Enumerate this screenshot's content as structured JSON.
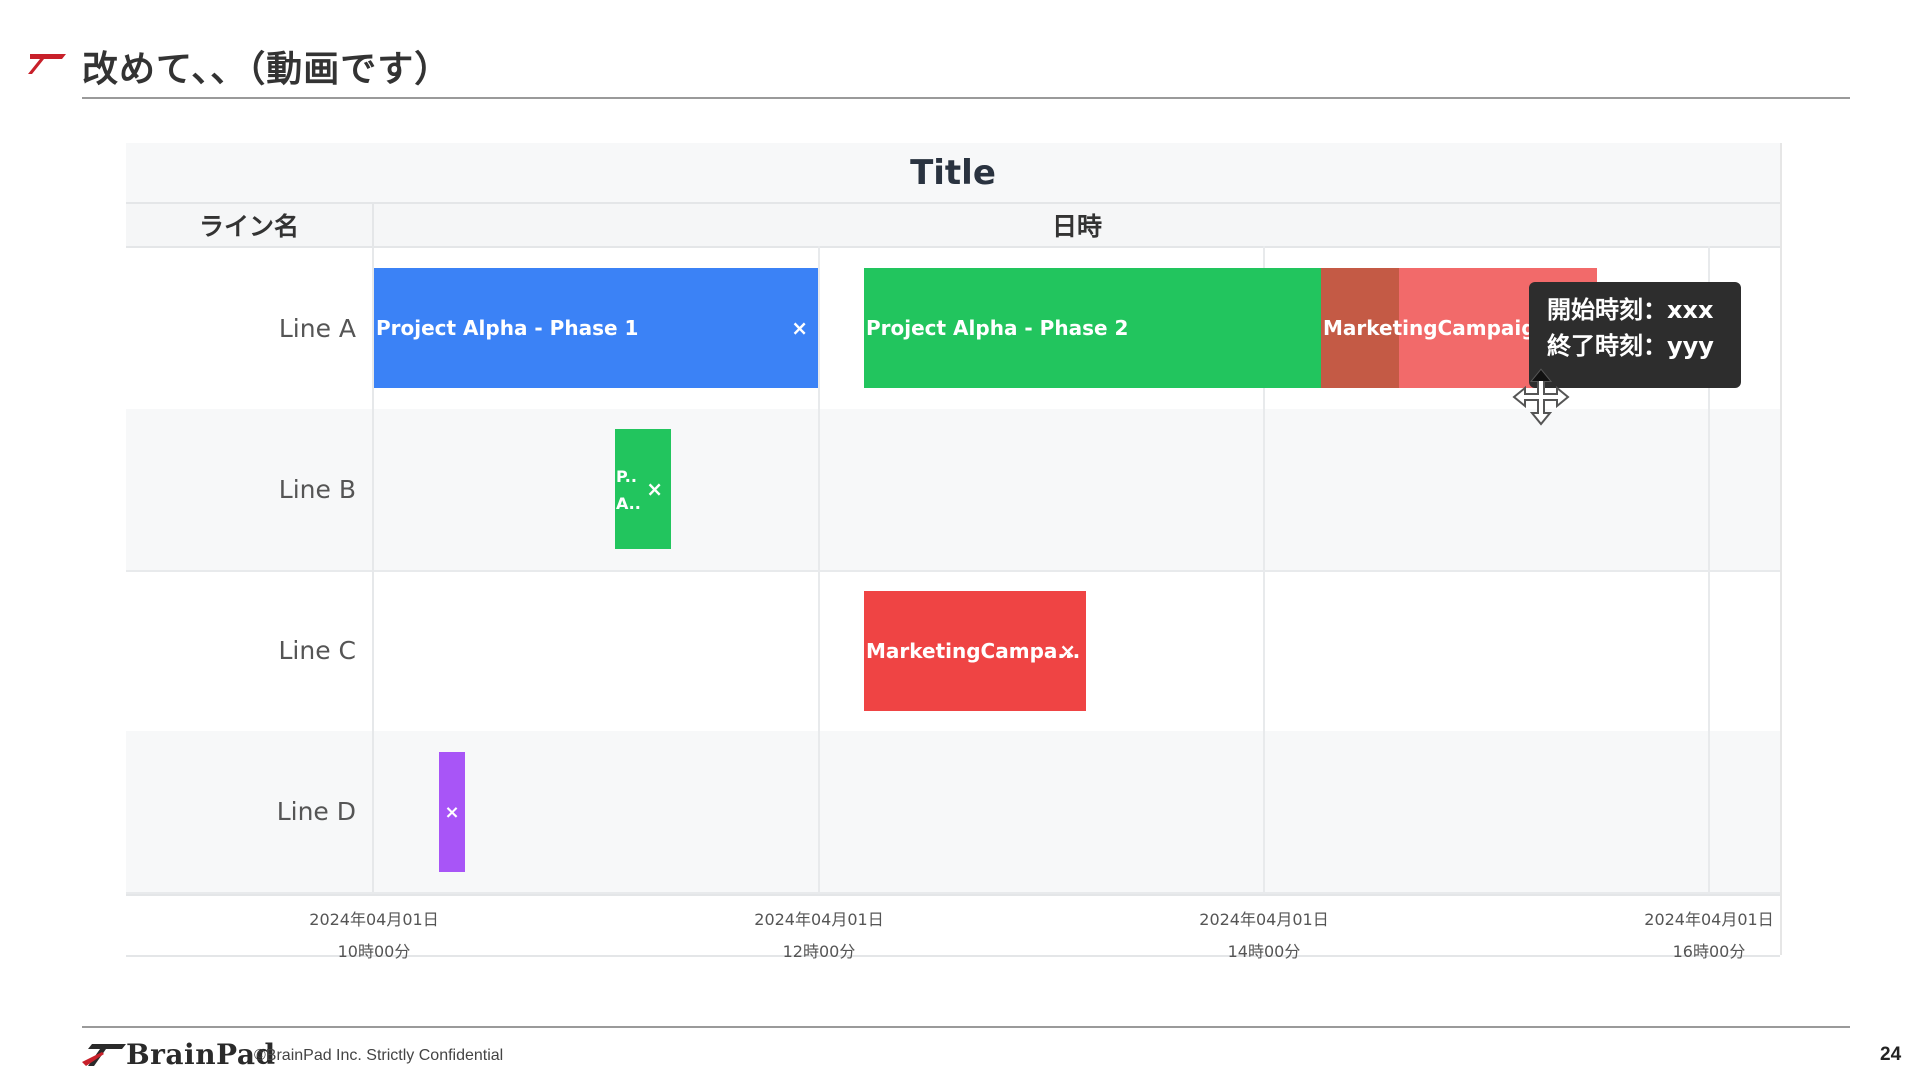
{
  "slide": {
    "title": "改めて、、（動画です）",
    "page_number": "24"
  },
  "gantt": {
    "title": "Title",
    "header_line": "ライン名",
    "header_time": "日時",
    "rows": [
      {
        "label": "Line A"
      },
      {
        "label": "Line B"
      },
      {
        "label": "Line C"
      },
      {
        "label": "Line D"
      }
    ],
    "bars": [
      {
        "label": "Project Alpha - Phase 1",
        "close": "×",
        "color": "#3b82f6"
      },
      {
        "label": "Project Alpha - Phase 2",
        "color": "#22c55e"
      },
      {
        "label": "MarketingCampaign",
        "color": "#f26a6a",
        "overlap_color": "#c45a45"
      },
      {
        "label": "P..",
        "label2": "A..",
        "close": "×",
        "color": "#22c55e"
      },
      {
        "label": "MarketingCampa...",
        "close": "×",
        "color": "#ef4444"
      },
      {
        "close": "×",
        "color": "#a855f7"
      }
    ],
    "axis_ticks": [
      {
        "date": "2024年04月01日",
        "time": "10時00分"
      },
      {
        "date": "2024年04月01日",
        "time": "12時00分"
      },
      {
        "date": "2024年04月01日",
        "time": "14時00分"
      },
      {
        "date": "2024年04月01日",
        "time": "16時00分"
      }
    ],
    "tooltip": {
      "start": "開始時刻：xxx",
      "end": "終了時刻：yyy"
    },
    "cursor_icon": "move-cursor-icon"
  },
  "footer": {
    "logo_text": "BrainPad",
    "copyright": "©BrainPad Inc.  Strictly Confidential"
  },
  "colors": {
    "accent_red": "#c8202a",
    "rule_gray": "#9a9a9a"
  }
}
